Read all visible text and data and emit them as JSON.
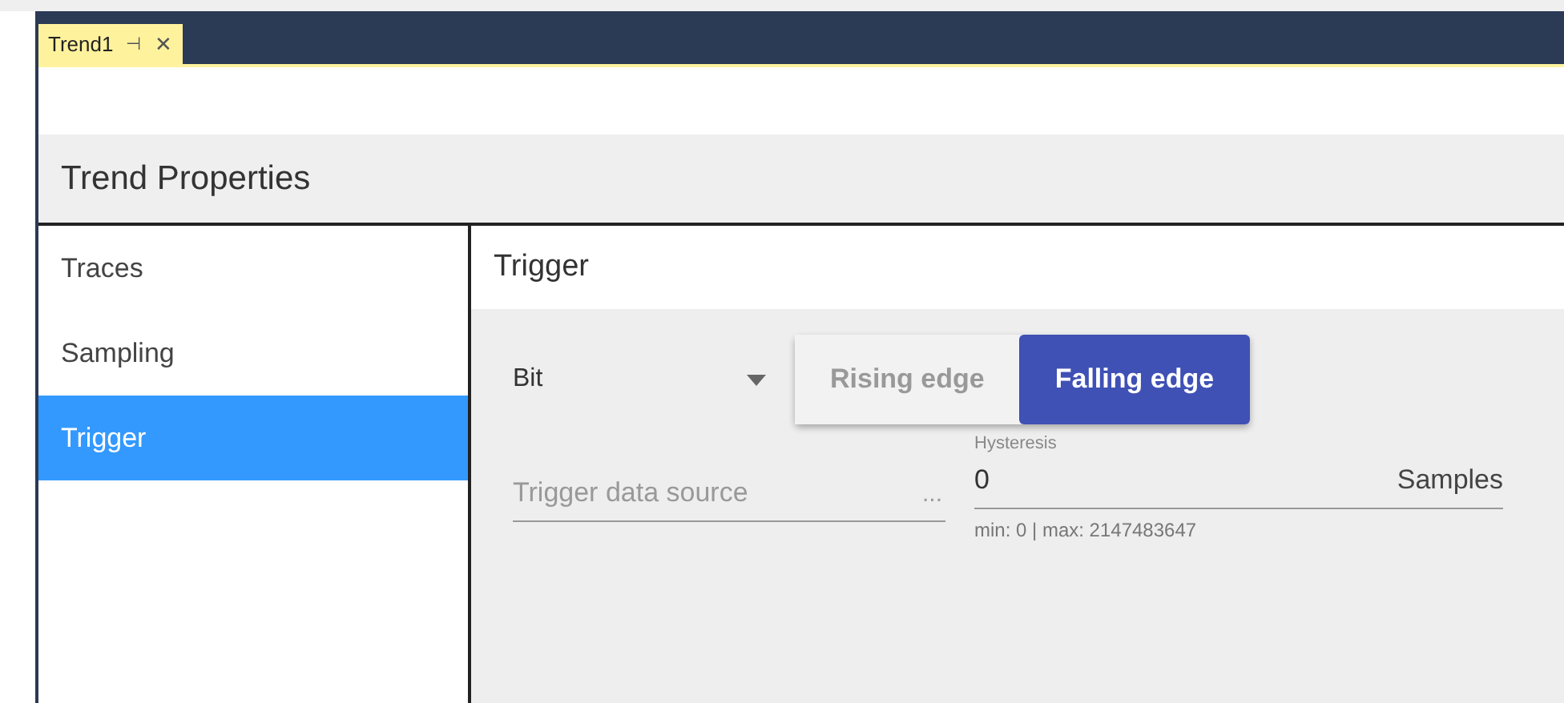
{
  "document_tab": {
    "title": "Trend1",
    "pin": "⊣",
    "close": "✕",
    "selected": true
  },
  "header": {
    "title": "Trend Properties"
  },
  "sidebar": {
    "items": [
      {
        "label": "Traces",
        "selected": false
      },
      {
        "label": "Sampling",
        "selected": false
      },
      {
        "label": "Trigger",
        "selected": true
      }
    ]
  },
  "panel": {
    "title": "Trigger",
    "type_dropdown": {
      "value": "Bit"
    },
    "edge_options": [
      {
        "label": "Rising edge",
        "selected": false
      },
      {
        "label": "Falling edge",
        "selected": true
      }
    ],
    "source_field": {
      "placeholder": "Trigger data source",
      "browse": "..."
    },
    "hysteresis": {
      "label": "Hysteresis",
      "value": "0",
      "unit": "Samples",
      "hint": "min: 0 | max: 2147483647"
    }
  }
}
